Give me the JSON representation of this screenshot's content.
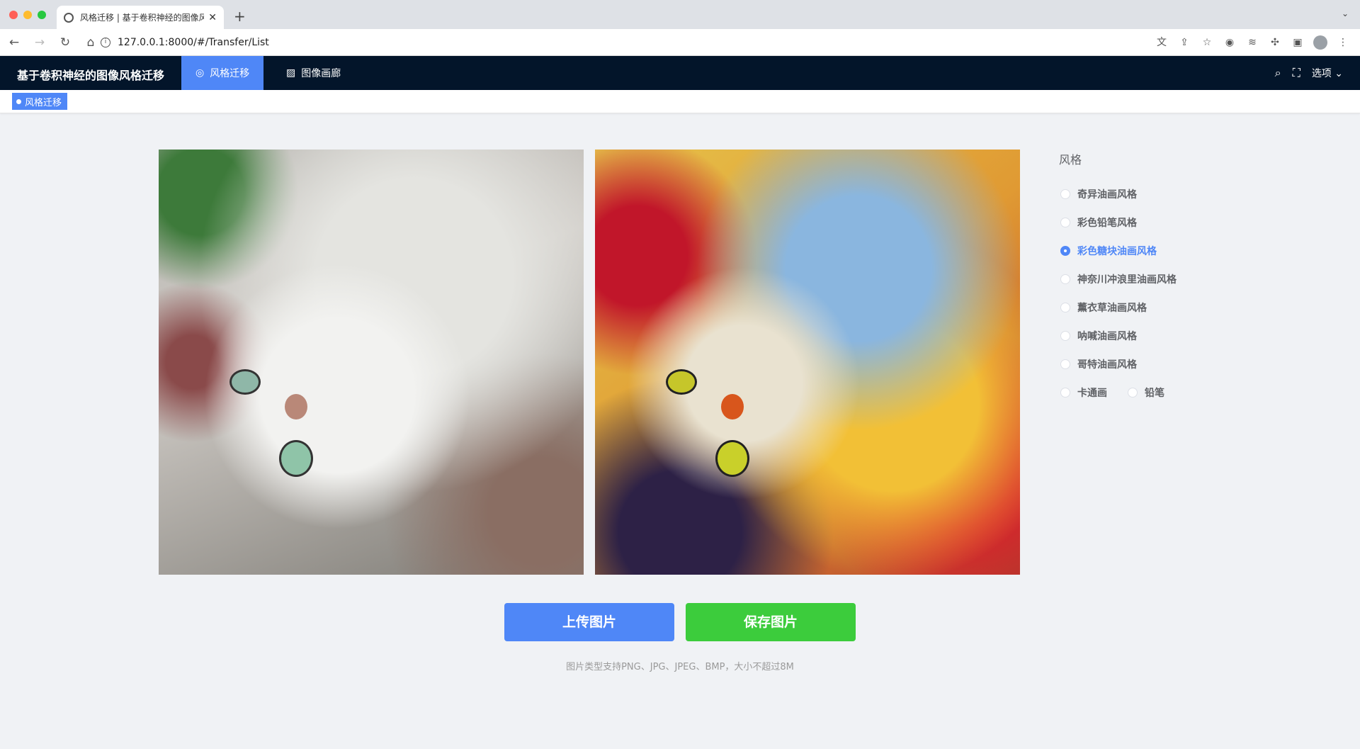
{
  "browser": {
    "tab_title": "风格迁移 | 基于卷积神经的图像风格迁移",
    "url": "127.0.0.1:8000/#/Transfer/List"
  },
  "app": {
    "title": "基于卷积神经的图像风格迁移",
    "nav": [
      {
        "label": "风格迁移",
        "icon": "style-icon",
        "active": true
      },
      {
        "label": "图像画廊",
        "icon": "image-icon",
        "active": false
      }
    ],
    "options_label": "选项"
  },
  "tags": [
    {
      "label": "风格迁移"
    }
  ],
  "styles": {
    "label": "风格",
    "options": [
      {
        "label": "奇异油画风格",
        "checked": false
      },
      {
        "label": "彩色铅笔风格",
        "checked": false
      },
      {
        "label": "彩色糖块油画风格",
        "checked": true
      },
      {
        "label": "神奈川冲浪里油画风格",
        "checked": false
      },
      {
        "label": "薰衣草油画风格",
        "checked": false
      },
      {
        "label": "呐喊油画风格",
        "checked": false
      },
      {
        "label": "哥特油画风格",
        "checked": false
      },
      {
        "label": "卡通画",
        "checked": false
      },
      {
        "label": "铅笔",
        "checked": false
      }
    ]
  },
  "actions": {
    "upload_label": "上传图片",
    "save_label": "保存图片",
    "hint": "图片类型支持PNG、JPG、JPEG、BMP，大小不超过8M"
  },
  "colors": {
    "primary": "#4f87f7",
    "success": "#3ccc3c",
    "header_bg": "#03152a"
  }
}
